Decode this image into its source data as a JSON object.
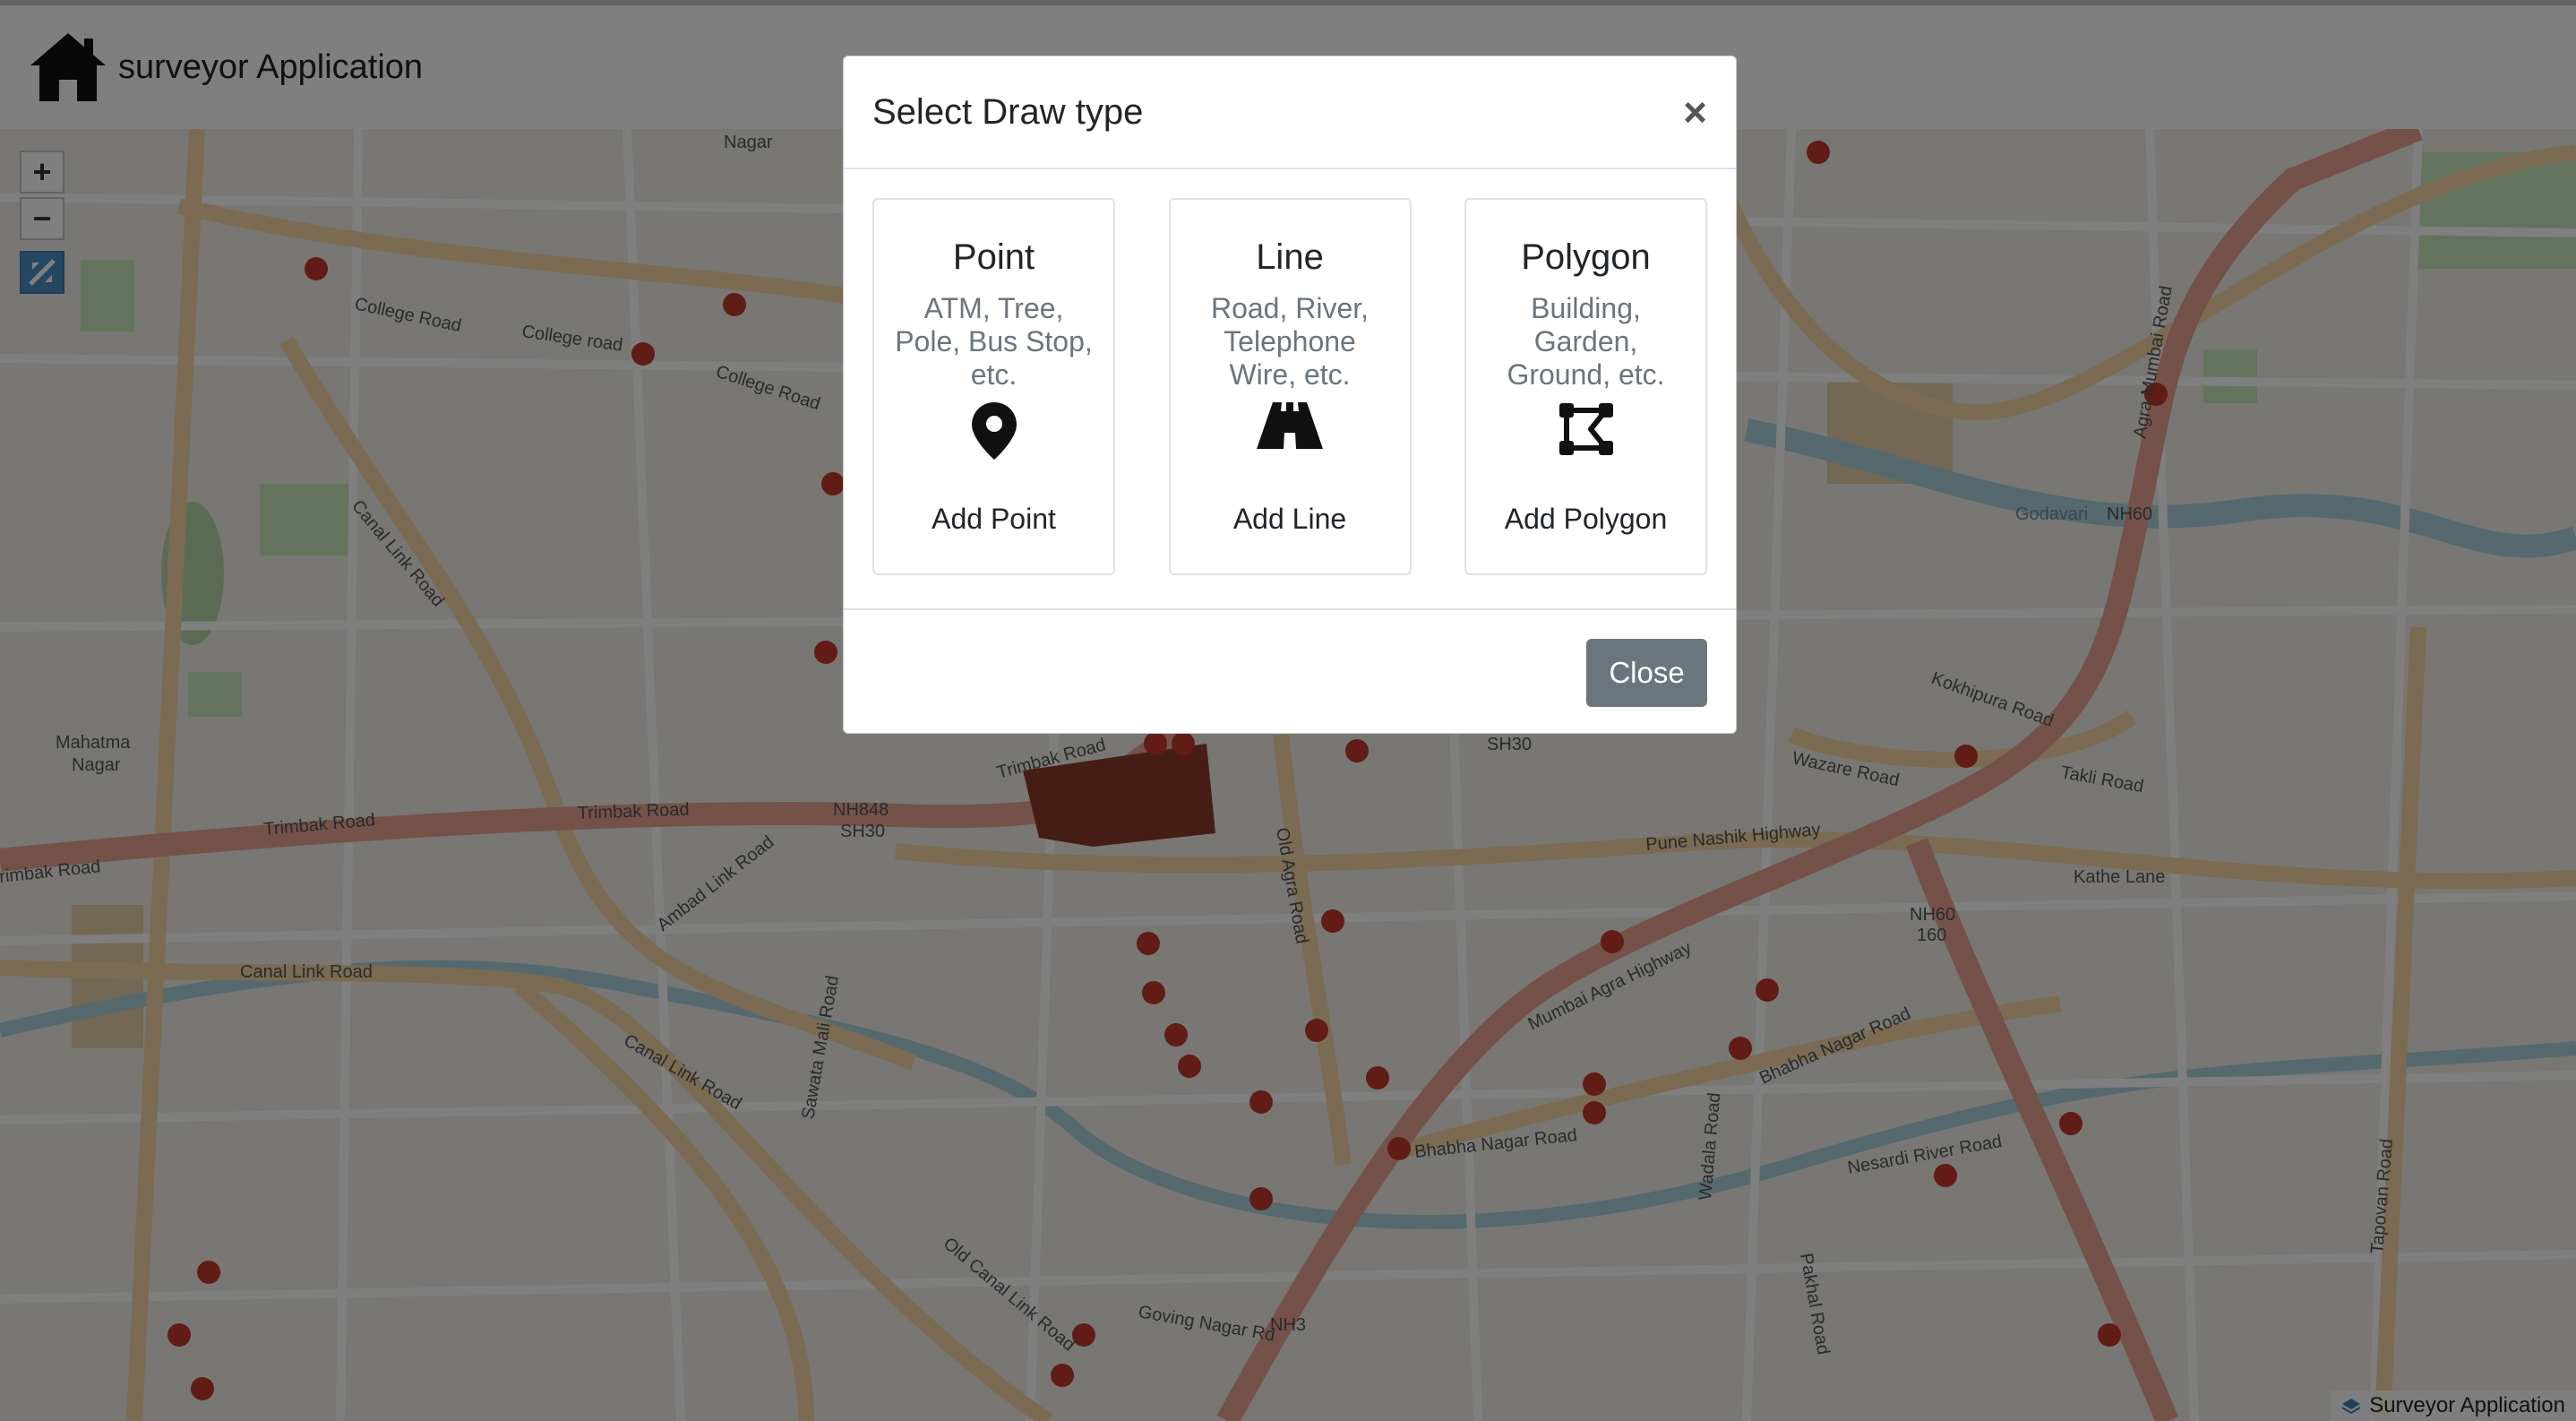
{
  "app": {
    "title": "surveyor Application"
  },
  "map": {
    "zoom_in_label": "+",
    "zoom_out_label": "−",
    "attribution": "Surveyor Application",
    "labels": [
      "College Road",
      "College road",
      "College Road",
      "Trimbak Road",
      "Trimbak Road",
      "Trimbak Road",
      "Canal Link Road",
      "Canal Link Road",
      "Canal Link Road",
      "Ambad Link Road",
      "Pune Nashik Highway",
      "Mumbai Agra Highway",
      "Agra Mumbai Road",
      "Old Agra Road",
      "Bhabha Nagar Road",
      "Bhabha Nagar Road",
      "Godavari",
      "SH30",
      "NH848",
      "NH60",
      "NH3",
      "Takli Road",
      "Kathe Lane",
      "Tapovan Road",
      "Wazare Road",
      "Kokhipura Road",
      "Pakhal Road",
      "Goving Nagar Rd",
      "Nagar",
      "Mahatma Nagar",
      "Canal Link Road",
      "Old Canal Link Road",
      "Sawata Mali Road",
      "Nasardi River Road",
      "Wadala Road"
    ],
    "colors": {
      "major_road": "#e8a492",
      "secondary_road": "#f4d7a4",
      "tertiary_road": "#ffffff",
      "river": "#aad3df",
      "park": "#c8e7bb",
      "marker": "#c0392b",
      "building": "#8b3a2a"
    }
  },
  "modal": {
    "title": "Select Draw type",
    "close_x": "×",
    "close_button": "Close",
    "options": [
      {
        "title": "Point",
        "description": "ATM, Tree, Pole, Bus Stop, etc.",
        "icon": "map-pin-icon",
        "action": "Add Point"
      },
      {
        "title": "Line",
        "description": "Road, River, Telephone Wire, etc.",
        "icon": "road-icon",
        "action": "Add Line"
      },
      {
        "title": "Polygon",
        "description": "Building, Garden, Ground, etc.",
        "icon": "draw-polygon-icon",
        "action": "Add Polygon"
      }
    ]
  }
}
